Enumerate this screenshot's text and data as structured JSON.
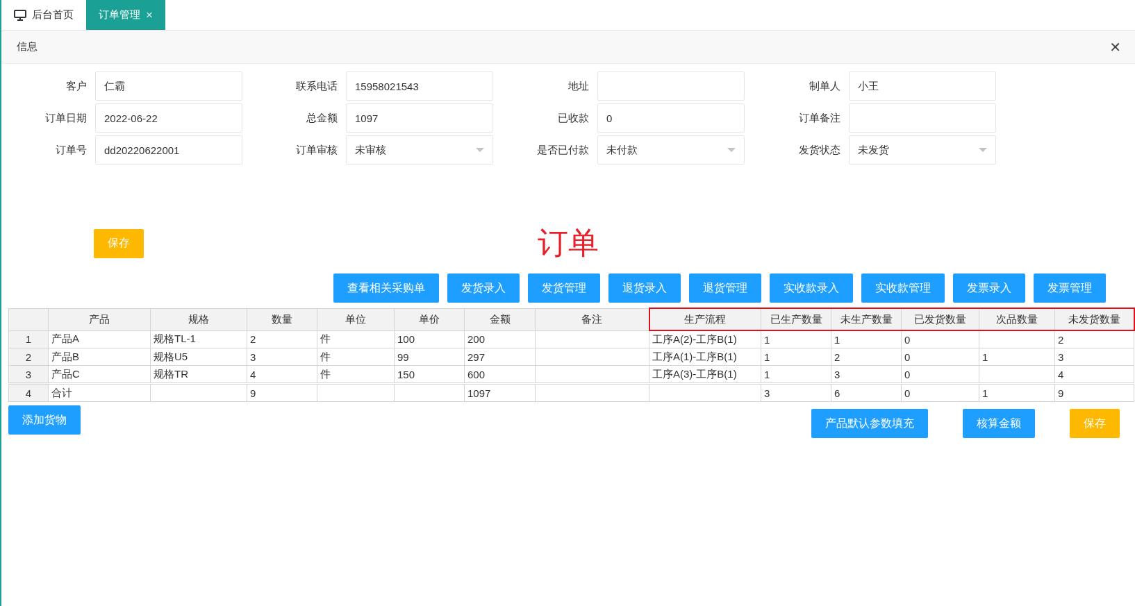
{
  "tabs": [
    {
      "label": "后台首页",
      "selected": false,
      "kind": "home"
    },
    {
      "label": "订单管理",
      "selected": true,
      "kind": "page",
      "close_glyph": "×"
    }
  ],
  "panel": {
    "title": "信息",
    "close_glyph": "✕"
  },
  "form_fields": [
    {
      "label": "客户",
      "kind": "text",
      "value": "仁霸"
    },
    {
      "label": "联系电话",
      "kind": "text",
      "value": "15958021543"
    },
    {
      "label": "地址",
      "kind": "text"
    },
    {
      "label": "制单人",
      "kind": "text",
      "value": "小王"
    },
    {
      "label": "订单日期",
      "kind": "text",
      "value": "2022-06-22"
    },
    {
      "label": "总金额",
      "kind": "text",
      "value": "1097"
    },
    {
      "label": "已收款",
      "kind": "text",
      "value": "0"
    },
    {
      "label": "订单备注",
      "kind": "text"
    },
    {
      "label": "订单号",
      "kind": "text",
      "value": "dd20220622001"
    },
    {
      "label": "订单审核",
      "kind": "select",
      "value": "未审核"
    },
    {
      "label": "是否已付款",
      "kind": "select",
      "value": "未付款"
    },
    {
      "label": "发货状态",
      "kind": "select",
      "value": "未发货"
    }
  ],
  "form_save_button": {
    "label": "保存",
    "kind": "warning"
  },
  "heading": "订单",
  "action_buttons": [
    "查看相关采购单",
    "发货录入",
    "发货管理",
    "退货录入",
    "退货管理",
    "实收款录入",
    "实收款管理",
    "发票录入",
    "发票管理"
  ],
  "table": {
    "columns": [
      {
        "highlighted": false
      },
      {
        "label": "产品",
        "highlighted": false
      },
      {
        "label": "规格",
        "highlighted": false
      },
      {
        "label": "数量",
        "highlighted": false
      },
      {
        "label": "单位",
        "highlighted": false
      },
      {
        "label": "单价",
        "highlighted": false
      },
      {
        "label": "金额",
        "highlighted": false
      },
      {
        "label": "备注",
        "highlighted": false
      },
      {
        "label": "生产流程",
        "highlighted": true
      },
      {
        "label": "已生产数量",
        "highlighted": true
      },
      {
        "label": "未生产数量",
        "highlighted": true
      },
      {
        "label": "已发货数量",
        "highlighted": true
      },
      {
        "label": "次品数量",
        "highlighted": true
      },
      {
        "label": "未发货数量",
        "highlighted": true
      }
    ],
    "rows": [
      {
        "kind": "item",
        "cells": [
          "1",
          "产品A",
          "规格TL-1",
          "2",
          "件",
          "100",
          "200",
          "",
          "工序A(2)-工序B(1)",
          "1",
          "1",
          "0",
          "",
          "2"
        ]
      },
      {
        "kind": "item",
        "cells": [
          "2",
          "产品B",
          "规格U5",
          "3",
          "件",
          "99",
          "297",
          "",
          "工序A(1)-工序B(1)",
          "1",
          "2",
          "0",
          "1",
          "3"
        ]
      },
      {
        "kind": "item",
        "cells": [
          "3",
          "产品C",
          "规格TR",
          "4",
          "件",
          "150",
          "600",
          "",
          "工序A(3)-工序B(1)",
          "1",
          "3",
          "0",
          "",
          "4"
        ]
      },
      {
        "kind": "total",
        "cells": [
          "4",
          "合计",
          "",
          "9",
          "",
          "",
          "1097",
          "",
          "",
          "3",
          "6",
          "0",
          "1",
          "9"
        ]
      }
    ]
  },
  "bottom_left_button": {
    "label": "添加货物",
    "kind": "primary"
  },
  "bottom_right_buttons": [
    {
      "label": "产品默认参数填充",
      "kind": "primary"
    },
    {
      "label": "核算金额",
      "kind": "primary"
    },
    {
      "label": "保存",
      "kind": "warning"
    }
  ]
}
